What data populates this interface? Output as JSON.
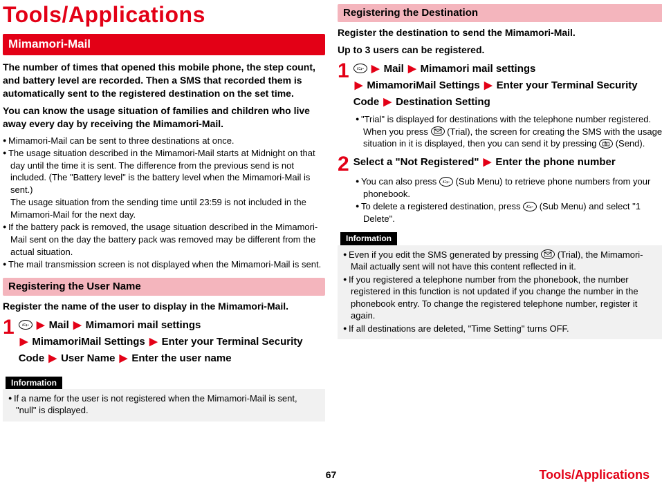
{
  "page_title": "Tools/Applications",
  "left": {
    "section_title": "Mimamori-Mail",
    "intro1": "The number of times that opened this mobile phone, the step count, and battery level are recorded. Then a SMS that recorded them is automatically sent to the registered destination on the set time.",
    "intro2": "You can know the usage situation of families and children who live away every day by receiving the Mimamori-Mail.",
    "bullets": [
      "Mimamori-Mail can be sent to three destinations at once."
    ],
    "bullet2": "The usage situation described in the Mimamori-Mail starts at Midnight on that day until the time it is sent. The difference from the previous send is not included. (The \"Battery level\" is the battery level when the Mimamori-Mail is sent.)",
    "bullet2b": "The usage situation from the sending time until 23:59 is not included in the Mimamori-Mail for the next day.",
    "bullet3": "If the battery pack is removed, the usage situation described in the Mimamori-Mail sent on the day the battery pack was removed may be different from the actual situation.",
    "bullet4": "The mail transmission screen is not displayed when the Mimamori-Mail is sent.",
    "sub_title": "Registering the User Name",
    "sub_intro": "Register the name of the user to display in the Mimamori-Mail.",
    "step1": {
      "s1": "Mail",
      "s2": "Mimamori mail settings",
      "s3": "MimamoriMail Settings",
      "s4": "Enter your Terminal Security Code",
      "s5": "User Name",
      "s6": "Enter the user name"
    },
    "info_label": "Information",
    "info_bullet": "If a name for the user is not registered when the Mimamori-Mail is sent, \"null\" is displayed."
  },
  "right": {
    "sub_title": "Registering the Destination",
    "intro1": "Register the destination to send the Mimamori-Mail.",
    "intro2": "Up to 3 users can be registered.",
    "step1": {
      "s1": "Mail",
      "s2": "Mimamori mail settings",
      "s3": "MimamoriMail Settings",
      "s4": "Enter your Terminal Security Code",
      "s5": "Destination Setting"
    },
    "step1_bullet_a": "\"Trial\" is displayed for destinations with the telephone number registered. When you press ",
    "step1_bullet_b": " (Trial), the screen for creating the SMS with the usage situation in it is displayed, then you can send it by pressing ",
    "step1_bullet_c": " (Send).",
    "step2_a": "Select a \"Not Registered\"",
    "step2_b": "Enter the phone number",
    "step2_bullet1_a": "You can also press ",
    "step2_bullet1_b": " (Sub Menu) to retrieve phone numbers from your phonebook.",
    "step2_bullet2_a": "To delete a registered destination, press ",
    "step2_bullet2_b": " (Sub Menu) and select \"1 Delete\".",
    "info_label": "Information",
    "info_b1_a": "Even if you edit the SMS generated by pressing ",
    "info_b1_b": " (Trial), the Mimamori-Mail actually sent will not have this content reflected in it.",
    "info_b2": "If you registered a telephone number from the phonebook, the number registered in this function is not updated if you change the number in the phonebook entry. To change the registered telephone number, register it again.",
    "info_b3": "If all destinations are deleted, \"Time Setting\" turns OFF."
  },
  "footer": {
    "page_num": "67",
    "section": "Tools/Applications"
  },
  "icons": {
    "menu": "メニュー",
    "mail_key": "mail",
    "camera_key": "camera"
  }
}
